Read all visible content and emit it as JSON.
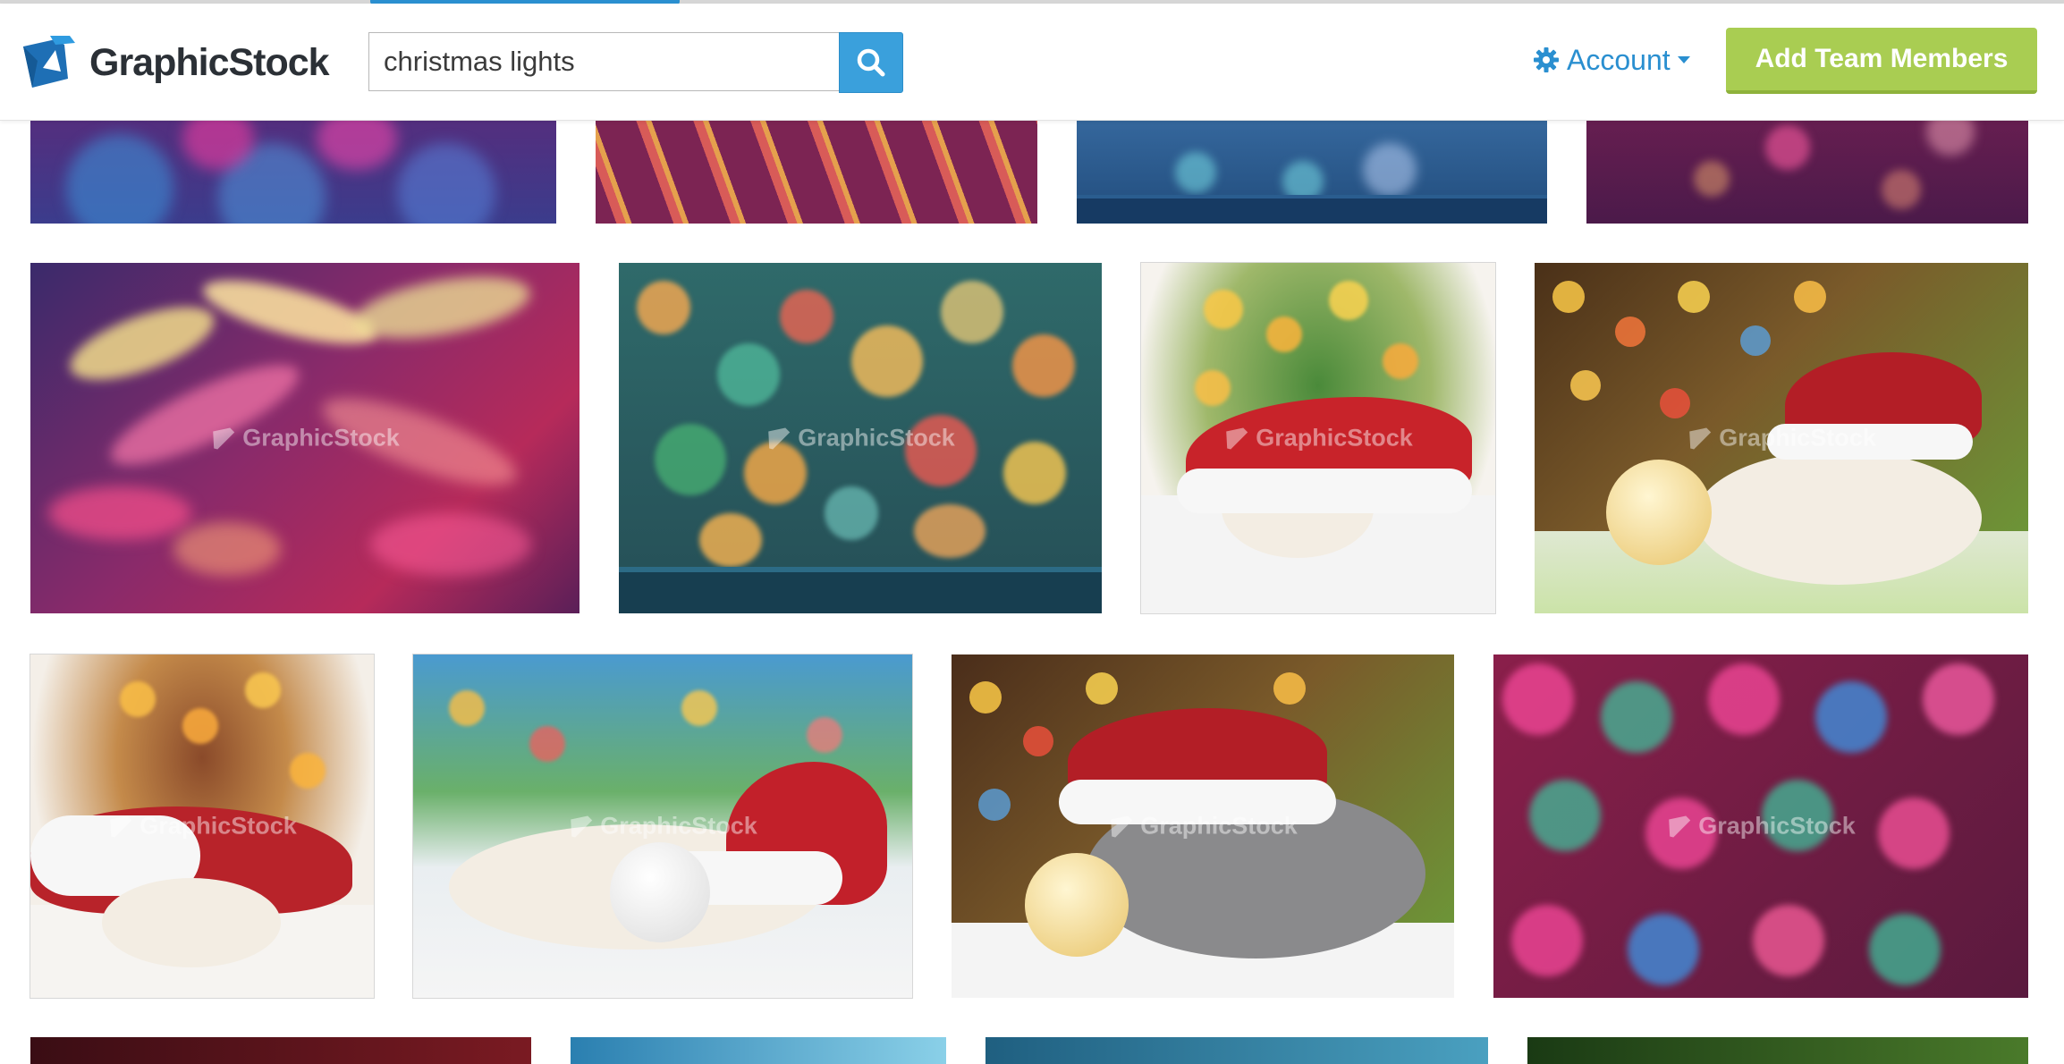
{
  "brand": {
    "name": "GraphicStock",
    "logo_icon": "graphicstock-logo-icon"
  },
  "search": {
    "value": "christmas lights",
    "button_icon": "search-icon"
  },
  "account": {
    "label": "Account",
    "icon": "gear-icon",
    "caret_icon": "caret-down-icon"
  },
  "cta": {
    "label": "Add Team Members",
    "color": "#a9cd52"
  },
  "colors": {
    "accent": "#2a8fd0",
    "search_button": "#3aa0dc",
    "cta": "#a9cd52"
  },
  "watermark": "GraphicStock"
}
